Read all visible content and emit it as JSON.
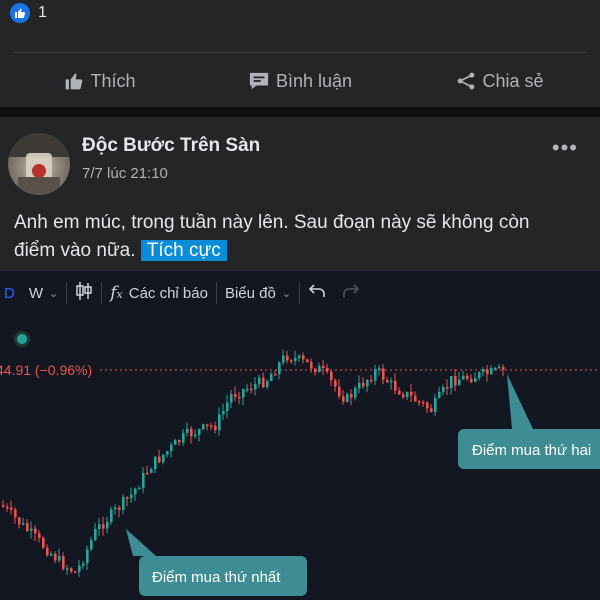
{
  "reactions": {
    "like_count": "1"
  },
  "actions": [
    {
      "icon": "thumbs-up-icon",
      "label": "Thích"
    },
    {
      "icon": "comment-icon",
      "label": "Bình luận"
    },
    {
      "icon": "share-icon",
      "label": "Chia sẻ"
    }
  ],
  "post": {
    "author": "Độc Bước Trên Sàn",
    "timestamp": "7/7 lúc 21:10",
    "text": "Anh em múc, trong tuần này lên. Sau đoạn này sẽ không còn điểm vào nữa.",
    "tag": "Tích cực"
  },
  "chart_toolbar": {
    "symbol_prefix": "D",
    "interval": "W",
    "indicators_label": "Các chỉ báo",
    "chart_type_label": "Biểu đồ"
  },
  "chart_data": {
    "type": "candlestick",
    "price_label": "44.91 (−0.96%)",
    "annotations": [
      "Điểm mua thứ nhất",
      "Điểm mua thứ hai"
    ],
    "colors": {
      "up": "#26a69a",
      "down": "#ef5350",
      "label_bg": "#3f8d94",
      "background": "#131722"
    }
  }
}
